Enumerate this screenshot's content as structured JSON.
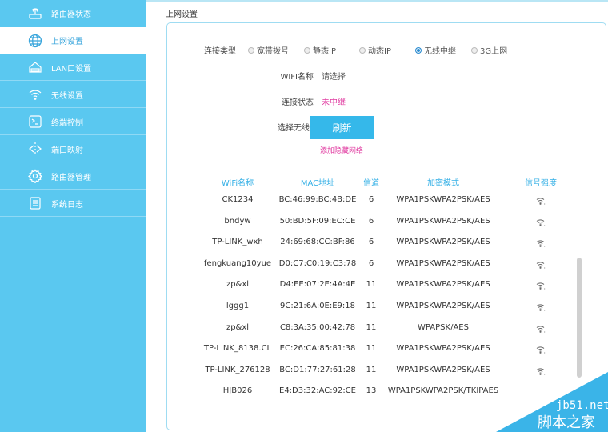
{
  "sidebar": {
    "items": [
      {
        "label": "路由器状态",
        "icon": "router-icon"
      },
      {
        "label": "上网设置",
        "icon": "globe-icon",
        "active": true
      },
      {
        "label": "LAN口设置",
        "icon": "lan-icon"
      },
      {
        "label": "无线设置",
        "icon": "wifi-icon"
      },
      {
        "label": "终端控制",
        "icon": "terminal-icon"
      },
      {
        "label": "端口映射",
        "icon": "port-map-icon"
      },
      {
        "label": "路由器管理",
        "icon": "gear-icon"
      },
      {
        "label": "系统日志",
        "icon": "log-icon"
      }
    ]
  },
  "page": {
    "title": "上网设置"
  },
  "form": {
    "conn_type_label": "连接类型",
    "options": [
      "宽带拨号",
      "静态IP",
      "动态IP",
      "无线中继",
      "3G上网"
    ],
    "selected": "无线中继",
    "wifi_name_label": "WIFI名称",
    "wifi_name_value": "请选择",
    "status_label": "连接状态",
    "status_value": "未中继",
    "select_label": "选择无线网",
    "refresh": "刷新",
    "add_hidden": "添加隐藏网络"
  },
  "table": {
    "headers": [
      "WiFi名称",
      "MAC地址",
      "信道",
      "加密模式",
      "信号强度"
    ],
    "rows": [
      [
        "CK1234",
        "BC:46:99:BC:4B:DE",
        "6",
        "WPA1PSKWPA2PSK/AES"
      ],
      [
        "bndyw",
        "50:BD:5F:09:EC:CE",
        "6",
        "WPA1PSKWPA2PSK/AES"
      ],
      [
        "TP-LINK_wxh",
        "24:69:68:CC:BF:86",
        "6",
        "WPA1PSKWPA2PSK/AES"
      ],
      [
        "fengkuang10yue",
        "D0:C7:C0:19:C3:78",
        "6",
        "WPA1PSKWPA2PSK/AES"
      ],
      [
        "zp&xl",
        "D4:EE:07:2E:4A:4E",
        "11",
        "WPA1PSKWPA2PSK/AES"
      ],
      [
        "lggg1",
        "9C:21:6A:0E:E9:18",
        "11",
        "WPA1PSKWPA2PSK/AES"
      ],
      [
        "zp&xl",
        "C8:3A:35:00:42:78",
        "11",
        "WPAPSK/AES"
      ],
      [
        "TP-LINK_8138.CL",
        "EC:26:CA:85:81:38",
        "11",
        "WPA1PSKWPA2PSK/AES"
      ],
      [
        "TP-LINK_276128",
        "BC:D1:77:27:61:28",
        "11",
        "WPA1PSKWPA2PSK/AES"
      ],
      [
        "HJB026",
        "E4:D3:32:AC:92:CE",
        "13",
        "WPA1PSKWPA2PSK/TKIPAES"
      ]
    ]
  },
  "watermark": {
    "site": "jb51.net",
    "name": "脚本之家"
  },
  "colors": {
    "sidebar": "#5ac8f0",
    "accent": "#35b8ea",
    "pink": "#e03aa0"
  }
}
